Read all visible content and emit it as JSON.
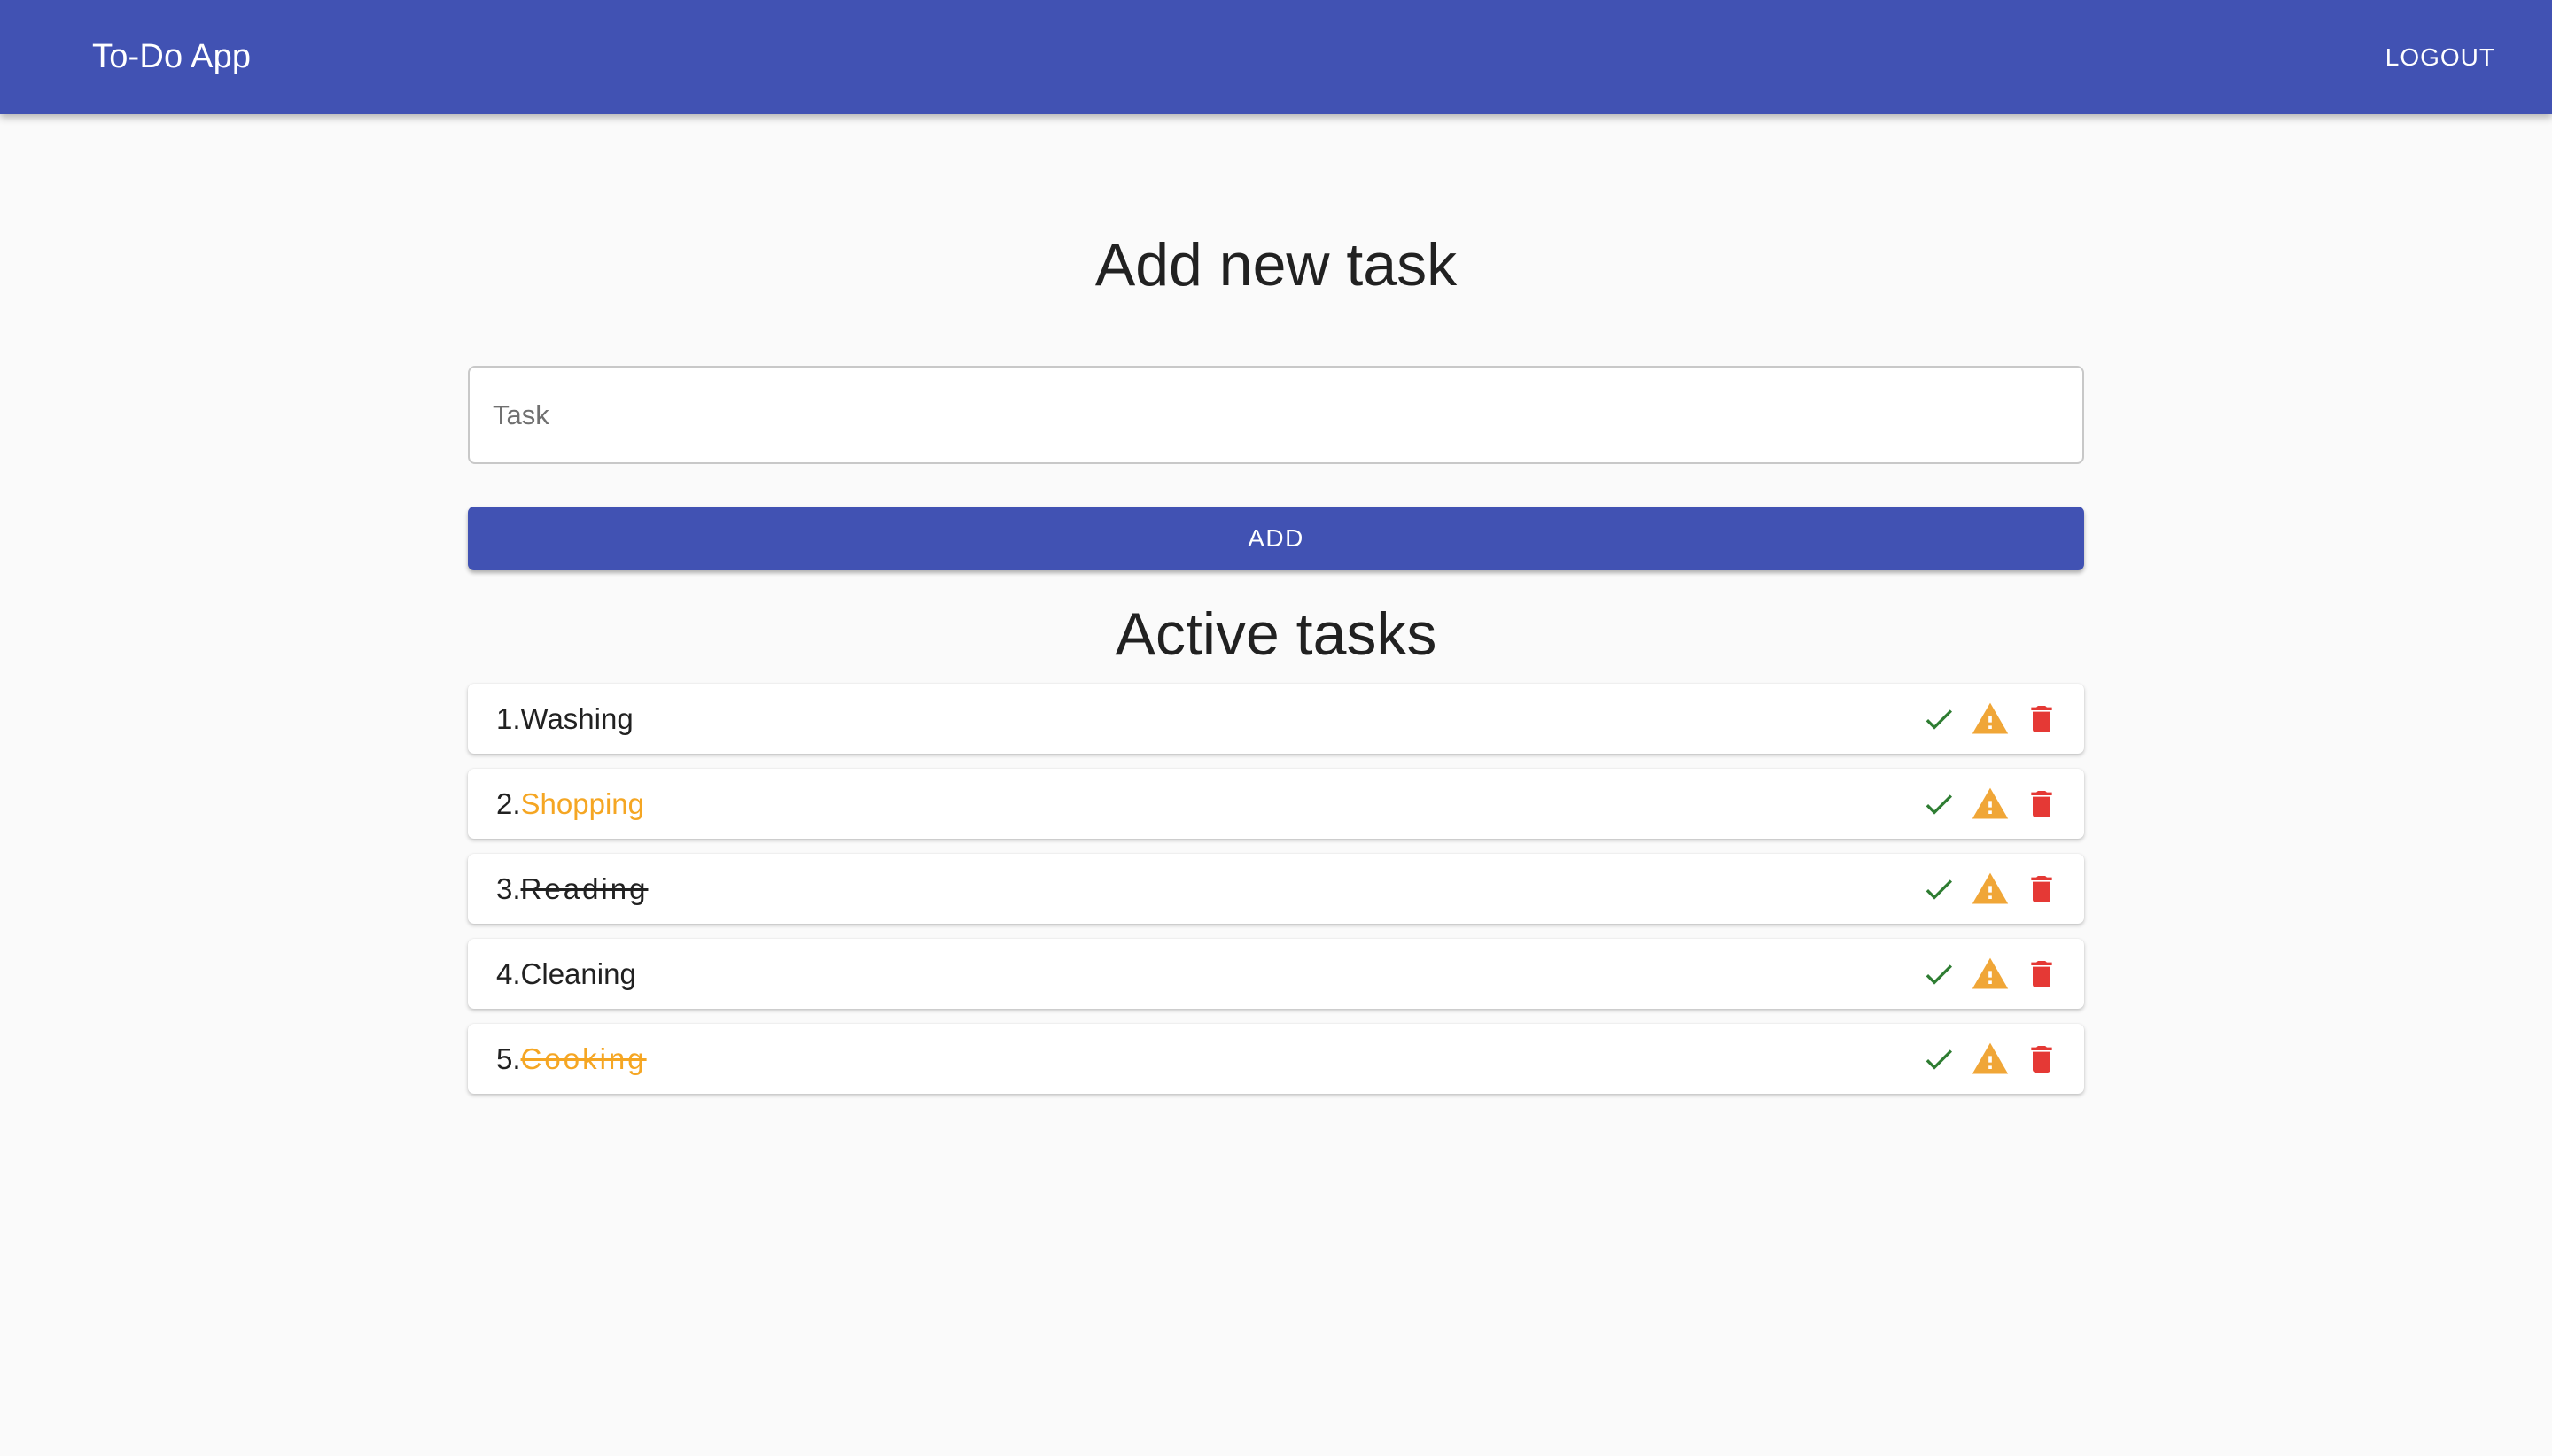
{
  "appbar": {
    "title": "To-Do App",
    "logout_label": "LOGOUT"
  },
  "add_section": {
    "heading": "Add new task",
    "input_placeholder": "Task",
    "input_value": "",
    "add_label": "ADD"
  },
  "active_section": {
    "heading": "Active tasks"
  },
  "tasks": [
    {
      "number": "1.",
      "name": "Washing",
      "important": false,
      "completed": false
    },
    {
      "number": "2.",
      "name": "Shopping",
      "important": true,
      "completed": false
    },
    {
      "number": "3.",
      "name": "Reading",
      "important": false,
      "completed": true
    },
    {
      "number": "4.",
      "name": "Cleaning",
      "important": false,
      "completed": false
    },
    {
      "number": "5.",
      "name": "Cooking",
      "important": true,
      "completed": true
    }
  ],
  "icons": {
    "complete": "check-icon",
    "important": "warning-icon",
    "delete": "trash-icon"
  },
  "colors": {
    "primary": "#4152b3",
    "important": "#f5a623",
    "check": "#2e7d32",
    "warning": "#f0a637",
    "delete": "#e53935"
  }
}
